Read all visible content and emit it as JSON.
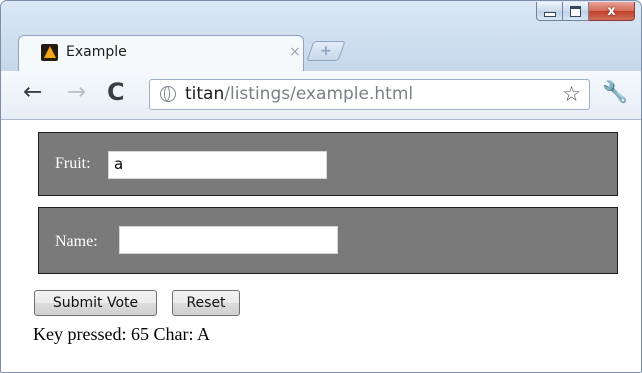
{
  "window": {
    "buttons": {
      "minimize_icon": "minimize-icon",
      "maximize_icon": "maximize-icon",
      "close_glyph": "x"
    }
  },
  "tab": {
    "title": "Example",
    "close_glyph": "×",
    "new_tab_glyph": "+"
  },
  "toolbar": {
    "back_glyph": "←",
    "forward_glyph": "→",
    "reload_glyph": "C",
    "url_host": "titan",
    "url_path": "/listings/example.html",
    "star_glyph": "☆",
    "wrench_glyph": "🔧"
  },
  "form": {
    "fruit_label": "Fruit:",
    "fruit_value": "a",
    "name_label": "Name:",
    "name_value": "",
    "submit_label": "Submit Vote",
    "reset_label": "Reset"
  },
  "status": {
    "text": "Key pressed: 65 Char: A"
  },
  "colors": {
    "panel_bg": "#7a7a7a",
    "close_button": "#c2402a"
  }
}
